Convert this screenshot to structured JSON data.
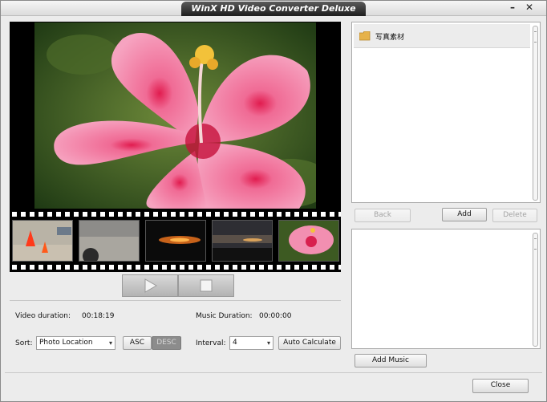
{
  "window": {
    "title": "WinX HD Video Converter Deluxe",
    "min_glyph": "–",
    "close_glyph": "✕"
  },
  "player": {
    "play_icon": "play-icon",
    "stop_icon": "stop-icon"
  },
  "info": {
    "video_duration_label": "Video duration:",
    "video_duration_value": "00:18:19",
    "music_duration_label": "Music Duration:",
    "music_duration_value": "00:00:00"
  },
  "sort": {
    "label": "Sort:",
    "selected": "Photo Location",
    "asc": "ASC",
    "desc": "DESC"
  },
  "interval": {
    "label": "Interval:",
    "value": "4",
    "auto_calculate": "Auto Calculate"
  },
  "folder_list": {
    "items": [
      {
        "icon": "folder-icon",
        "label": "写真素材"
      }
    ]
  },
  "folder_buttons": {
    "back": "Back",
    "add": "Add",
    "delete": "Delete"
  },
  "music": {
    "add_music": "Add Music"
  },
  "footer": {
    "close": "Close"
  },
  "colors": {
    "title_tab": "#2b2b2b",
    "desc_bg": "#8c8c8c",
    "list_selected": "#ececec"
  }
}
